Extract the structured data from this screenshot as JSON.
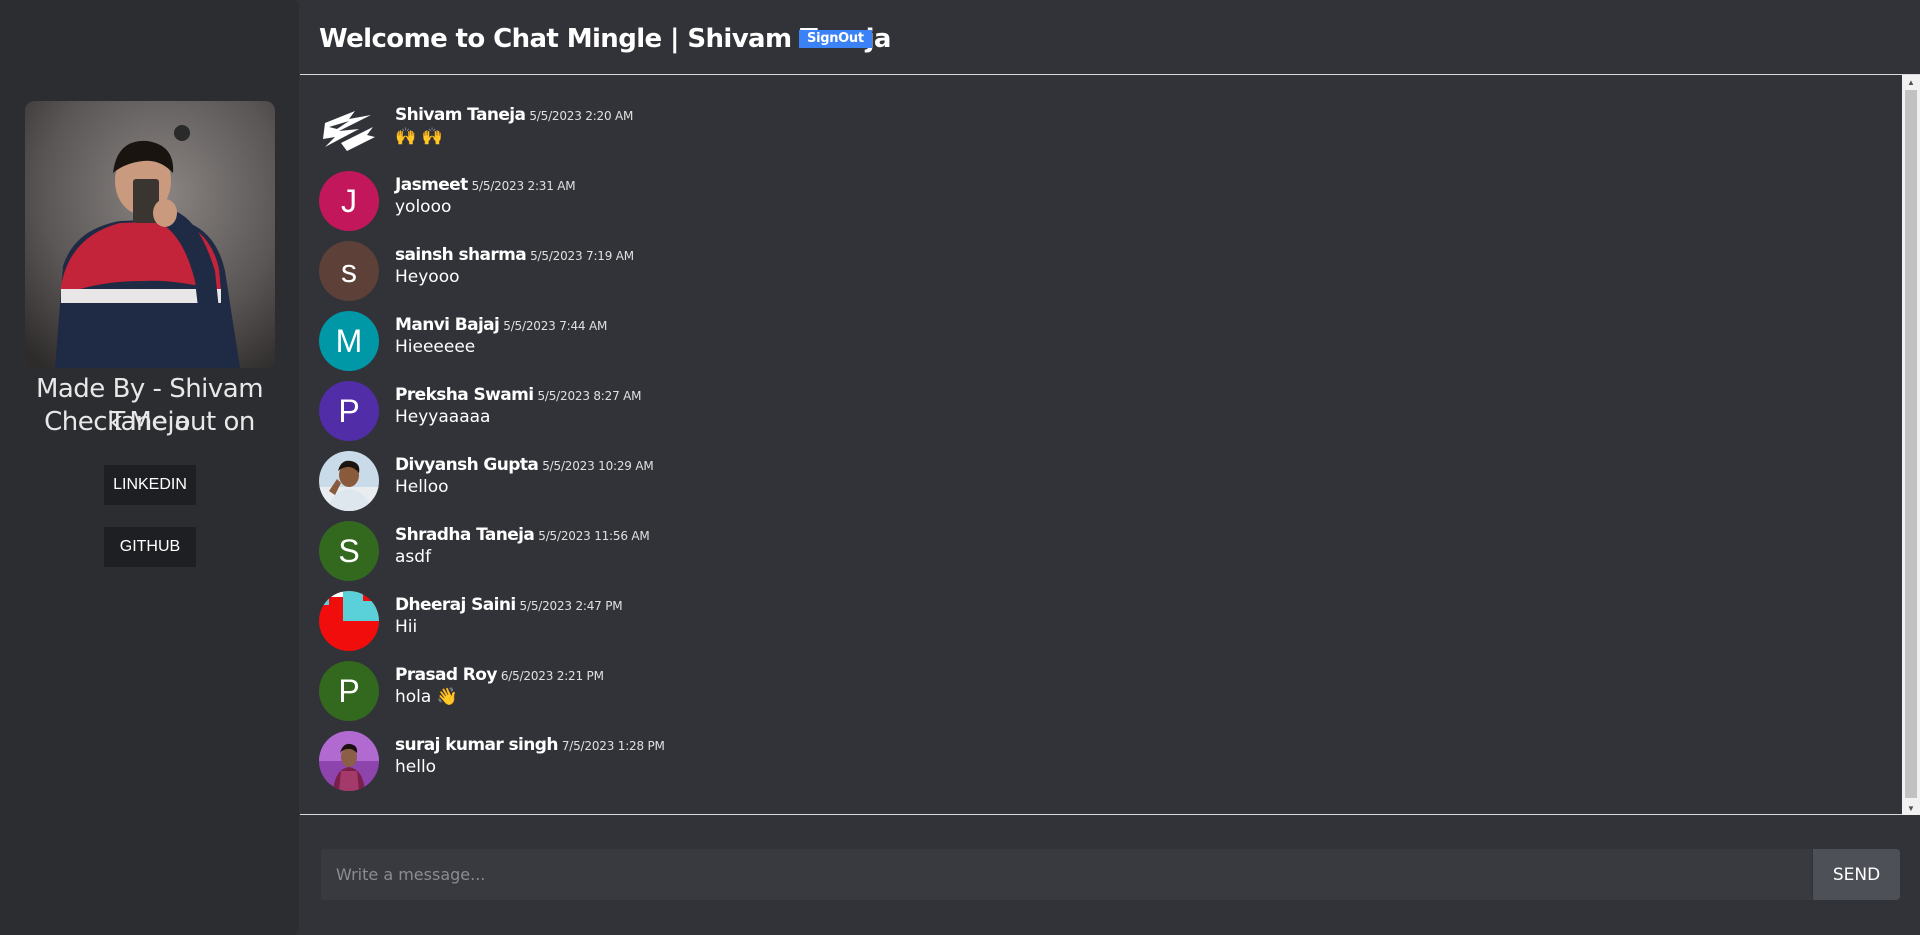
{
  "sidebar": {
    "made_by": "Made By - Shivam Taneja",
    "check_me": "Check Me out on",
    "linkedin_label": "LINKEDIN",
    "github_label": "GITHUB"
  },
  "header": {
    "title": "Welcome to Chat Mingle | Shivam Taneja",
    "signout_label": "SignOut"
  },
  "messages": [
    {
      "name": "Shivam Taneja",
      "time": "5/5/2023 2:20 AM",
      "text": "🙌 🙌",
      "avatar_type": "logo",
      "avatar_letter": "",
      "avatar_color": "#313338"
    },
    {
      "name": "Jasmeet",
      "time": "5/5/2023 2:31 AM",
      "text": "yolooo",
      "avatar_type": "letter",
      "avatar_letter": "J",
      "avatar_color": "#c2185b"
    },
    {
      "name": "sainsh sharma",
      "time": "5/5/2023 7:19 AM",
      "text": "Heyooo",
      "avatar_type": "letter",
      "avatar_letter": "s",
      "avatar_color": "#5d4037"
    },
    {
      "name": "Manvi Bajaj",
      "time": "5/5/2023 7:44 AM",
      "text": "Hieeeeee",
      "avatar_type": "letter",
      "avatar_letter": "M",
      "avatar_color": "#0097a7"
    },
    {
      "name": "Preksha Swami",
      "time": "5/5/2023 8:27 AM",
      "text": "Heyyaaaaa",
      "avatar_type": "letter",
      "avatar_letter": "P",
      "avatar_color": "#512da8"
    },
    {
      "name": "Divyansh Gupta",
      "time": "5/5/2023 10:29 AM",
      "text": "Helloo",
      "avatar_type": "photo",
      "avatar_letter": "",
      "avatar_color": "#9ab7cf"
    },
    {
      "name": "Shradha Taneja",
      "time": "5/5/2023 11:56 AM",
      "text": "asdf",
      "avatar_type": "letter",
      "avatar_letter": "S",
      "avatar_color": "#33691e"
    },
    {
      "name": "Dheeraj Saini",
      "time": "5/5/2023 2:47 PM",
      "text": "Hii",
      "avatar_type": "pattern",
      "avatar_letter": "",
      "avatar_color": "#ff0000"
    },
    {
      "name": "Prasad Roy",
      "time": "6/5/2023 2:21 PM",
      "text": "hola 👋",
      "avatar_type": "letter",
      "avatar_letter": "P",
      "avatar_color": "#33691e"
    },
    {
      "name": "suraj kumar singh",
      "time": "7/5/2023 1:28 PM",
      "text": "hello",
      "avatar_type": "photo2",
      "avatar_letter": "",
      "avatar_color": "#8e44ad"
    }
  ],
  "composer": {
    "placeholder": "Write a message...",
    "send_label": "SEND"
  },
  "colors": {
    "background": "#313338",
    "sidebar": "#2b2d31",
    "signout": "#3b82f6",
    "send_button": "#4e5058"
  }
}
